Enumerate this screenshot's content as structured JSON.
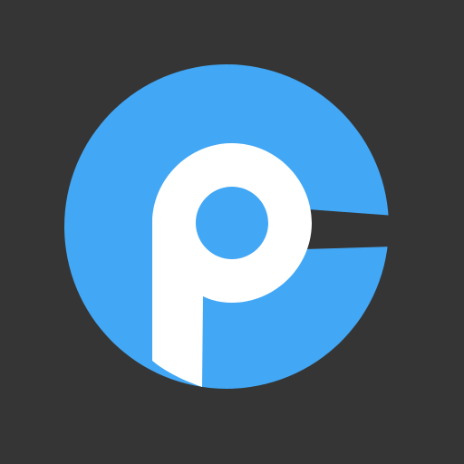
{
  "icon": {
    "name": "app-logo-icon",
    "colors": {
      "background": "#353535",
      "circle": "#42a7f5",
      "letter": "#ffffff",
      "slit": "#353535"
    }
  }
}
